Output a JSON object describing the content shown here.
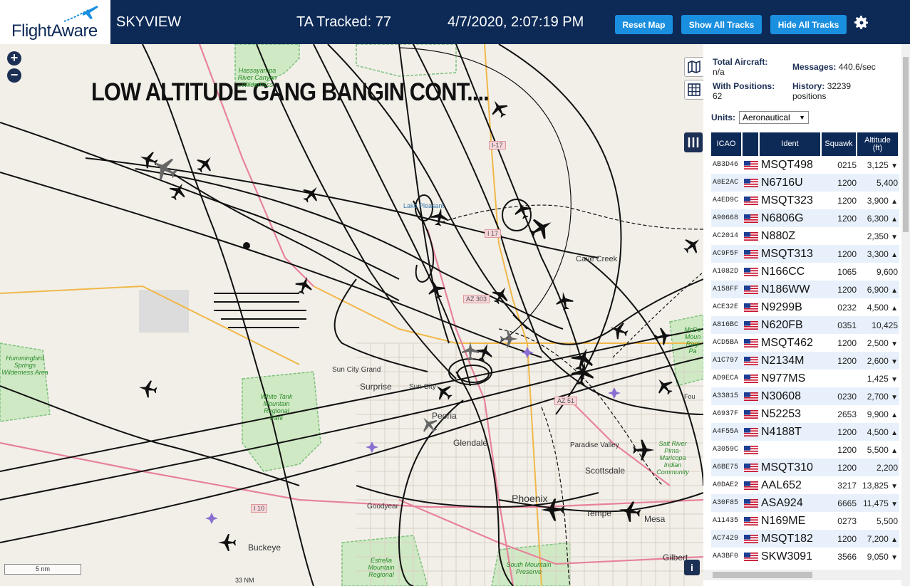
{
  "header": {
    "logo": "FlightAware",
    "app": "SKYVIEW",
    "tracked": "TA Tracked: 77",
    "datetime": "4/7/2020, 2:07:19 PM",
    "btn_reset": "Reset Map",
    "btn_show": "Show All Tracks",
    "btn_hide": "Hide All Tracks"
  },
  "map": {
    "overlay_text": "LOW ALTITUDE GANG BANGIN CONT....",
    "scale": "5 nm",
    "places": [
      "Cave Creek",
      "Sun City Grand",
      "Surprise",
      "Sun City",
      "Peoria",
      "Glendale",
      "Paradise Valley",
      "Scottsdale",
      "Phoenix",
      "Tempe",
      "Mesa",
      "Goodyear",
      "Buckeye",
      "Gilbert",
      "Lake Pleasant",
      "Fou",
      "33 NM"
    ],
    "parks": [
      "Hassayampa River Canyon Wilderness",
      "Hummingbird Springs Wilderness Area",
      "White Tank Mountain Regional Park",
      "Estrella Mountain Regional",
      "South Mountain Preserve",
      "McDo Moun Regi Pa",
      "Salt River Pima-Maricopa Indian Community"
    ],
    "highways": [
      "I-17",
      "I 17",
      "AZ 303",
      "AZ 51",
      "I 10"
    ]
  },
  "sidebar": {
    "total_label": "Total Aircraft:",
    "total_value": "n/a",
    "positions_label": "With Positions:",
    "positions_value": "62",
    "messages_label": "Messages:",
    "messages_value": "440.6/sec",
    "history_label": "History:",
    "history_value": "32239",
    "history_unit": "positions",
    "units_label": "Units:",
    "units_value": "Aeronautical",
    "columns": [
      "ICAO",
      "Ident",
      "Squawk",
      "Altitude (ft)"
    ],
    "rows": [
      {
        "icao": "AB3D46",
        "ident": "MSQT498",
        "squawk": "0215",
        "alt": "3,125",
        "trend": "▼"
      },
      {
        "icao": "A8E2AC",
        "ident": "N6716U",
        "squawk": "1200",
        "alt": "5,400",
        "trend": ""
      },
      {
        "icao": "A4ED9C",
        "ident": "MSQT323",
        "squawk": "1200",
        "alt": "3,900",
        "trend": "▲"
      },
      {
        "icao": "A90668",
        "ident": "N6806G",
        "squawk": "1200",
        "alt": "6,300",
        "trend": "▲"
      },
      {
        "icao": "AC2014",
        "ident": "N880Z",
        "squawk": "",
        "alt": "2,350",
        "trend": "▼"
      },
      {
        "icao": "AC9F5F",
        "ident": "MSQT313",
        "squawk": "1200",
        "alt": "3,300",
        "trend": "▲"
      },
      {
        "icao": "A1082D",
        "ident": "N166CC",
        "squawk": "1065",
        "alt": "9,600",
        "trend": ""
      },
      {
        "icao": "A158FF",
        "ident": "N186WW",
        "squawk": "1200",
        "alt": "6,900",
        "trend": "▲"
      },
      {
        "icao": "ACE32E",
        "ident": "N9299B",
        "squawk": "0232",
        "alt": "4,500",
        "trend": "▲"
      },
      {
        "icao": "A816BC",
        "ident": "N620FB",
        "squawk": "0351",
        "alt": "10,425",
        "trend": ""
      },
      {
        "icao": "ACD5BA",
        "ident": "MSQT462",
        "squawk": "1200",
        "alt": "2,500",
        "trend": "▼"
      },
      {
        "icao": "A1C797",
        "ident": "N2134M",
        "squawk": "1200",
        "alt": "2,600",
        "trend": "▼"
      },
      {
        "icao": "AD9ECA",
        "ident": "N977MS",
        "squawk": "",
        "alt": "1,425",
        "trend": "▼"
      },
      {
        "icao": "A33815",
        "ident": "N30608",
        "squawk": "0230",
        "alt": "2,700",
        "trend": "▼"
      },
      {
        "icao": "A6937F",
        "ident": "N52253",
        "squawk": "2653",
        "alt": "9,900",
        "trend": "▲"
      },
      {
        "icao": "A4F55A",
        "ident": "N4188T",
        "squawk": "1200",
        "alt": "4,500",
        "trend": "▲"
      },
      {
        "icao": "A3059C",
        "ident": "",
        "squawk": "1200",
        "alt": "5,500",
        "trend": "▲"
      },
      {
        "icao": "A6BE75",
        "ident": "MSQT310",
        "squawk": "1200",
        "alt": "2,200",
        "trend": ""
      },
      {
        "icao": "A0DAE2",
        "ident": "AAL652",
        "squawk": "3217",
        "alt": "13,825",
        "trend": "▼"
      },
      {
        "icao": "A30F85",
        "ident": "ASA924",
        "squawk": "6665",
        "alt": "11,475",
        "trend": "▼"
      },
      {
        "icao": "A11435",
        "ident": "N169ME",
        "squawk": "0273",
        "alt": "5,500",
        "trend": ""
      },
      {
        "icao": "AC7429",
        "ident": "MSQT182",
        "squawk": "1200",
        "alt": "7,200",
        "trend": "▲"
      },
      {
        "icao": "AA3BF0",
        "ident": "SKW3091",
        "squawk": "3566",
        "alt": "9,050",
        "trend": "▼"
      }
    ]
  },
  "colors": {
    "header_bg": "#0d2a57",
    "button_bg": "#1a8fe0",
    "map_bg": "#f2efe9",
    "track": "#111111"
  }
}
